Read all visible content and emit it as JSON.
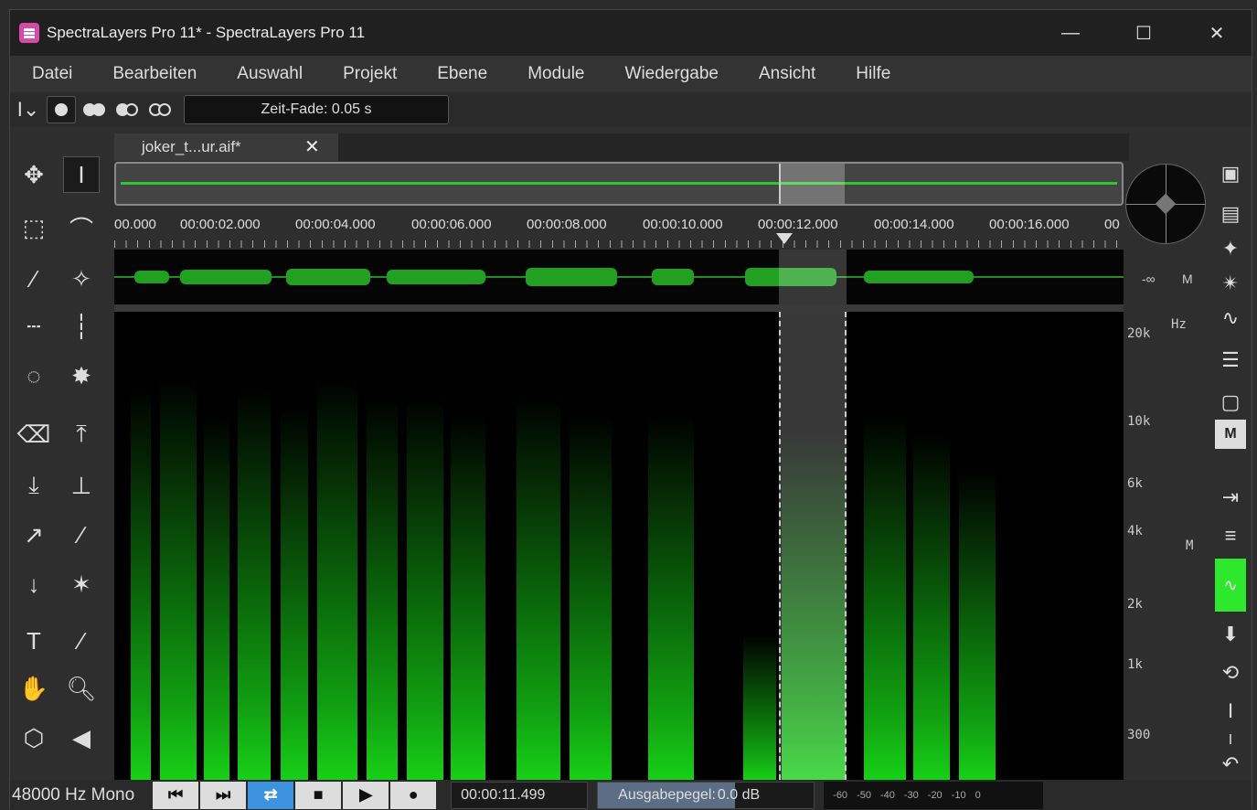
{
  "window": {
    "title": "SpectraLayers Pro 11* - SpectraLayers Pro 11",
    "minimize": "—",
    "maximize": "☐",
    "close": "✕"
  },
  "menu": [
    "Datei",
    "Bearbeiten",
    "Auswahl",
    "Projekt",
    "Ebene",
    "Module",
    "Wiedergabe",
    "Ansicht",
    "Hilfe"
  ],
  "toolbar": {
    "fade_label": "Zeit-Fade: 0.05 s"
  },
  "tab": {
    "name": "joker_t...ur.aif*",
    "close": "✕"
  },
  "ruler_labels": [
    "00.000",
    "00:00:02.000",
    "00:00:04.000",
    "00:00:06.000",
    "00:00:08.000",
    "00:00:10.000",
    "00:00:12.000",
    "00:00:14.000",
    "00:00:16.000",
    "00"
  ],
  "frequency_labels": {
    "unit": "Hz",
    "ticks": [
      "20k",
      "10k",
      "6k",
      "4k",
      "2k",
      "1k",
      "300"
    ]
  },
  "meter": {
    "level": "-∞",
    "mode": "M"
  },
  "side_panel": {
    "m_button": "M",
    "m_label": "M"
  },
  "status": {
    "format": "48000 Hz Mono",
    "time": "00:00:11.499",
    "output_label": "Ausgabepegel:",
    "output_value": "0.0 dB",
    "scale": [
      "-60",
      "-50",
      "-40",
      "-30",
      "-20",
      "-10",
      "0"
    ]
  },
  "colors": {
    "waveform": "#22a022",
    "spectrogram": "#17d017",
    "accent": "#3d93e0"
  }
}
